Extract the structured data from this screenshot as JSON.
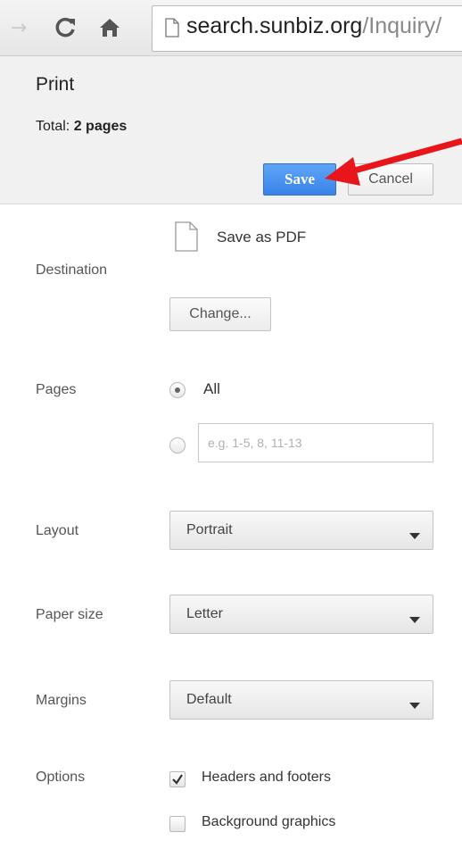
{
  "browser": {
    "url_domain": "search.sunbiz.org",
    "url_path": "/Inquiry/"
  },
  "print": {
    "title": "Print",
    "total_label": "Total:",
    "total_value": "2 pages",
    "save_label": "Save",
    "cancel_label": "Cancel"
  },
  "destination": {
    "label": "Destination",
    "name": "Save as PDF",
    "change_label": "Change..."
  },
  "pages": {
    "label": "Pages",
    "all_label": "All",
    "selected": "All",
    "range_placeholder": "e.g. 1-5, 8, 11-13"
  },
  "layout": {
    "label": "Layout",
    "value": "Portrait"
  },
  "paper_size": {
    "label": "Paper size",
    "value": "Letter"
  },
  "margins": {
    "label": "Margins",
    "value": "Default"
  },
  "options": {
    "label": "Options",
    "items": [
      {
        "label": "Headers and footers",
        "checked": true
      },
      {
        "label": "Background graphics",
        "checked": false
      }
    ]
  },
  "colors": {
    "save_button": "#3a82e8",
    "annotation_arrow": "#e8151b"
  }
}
